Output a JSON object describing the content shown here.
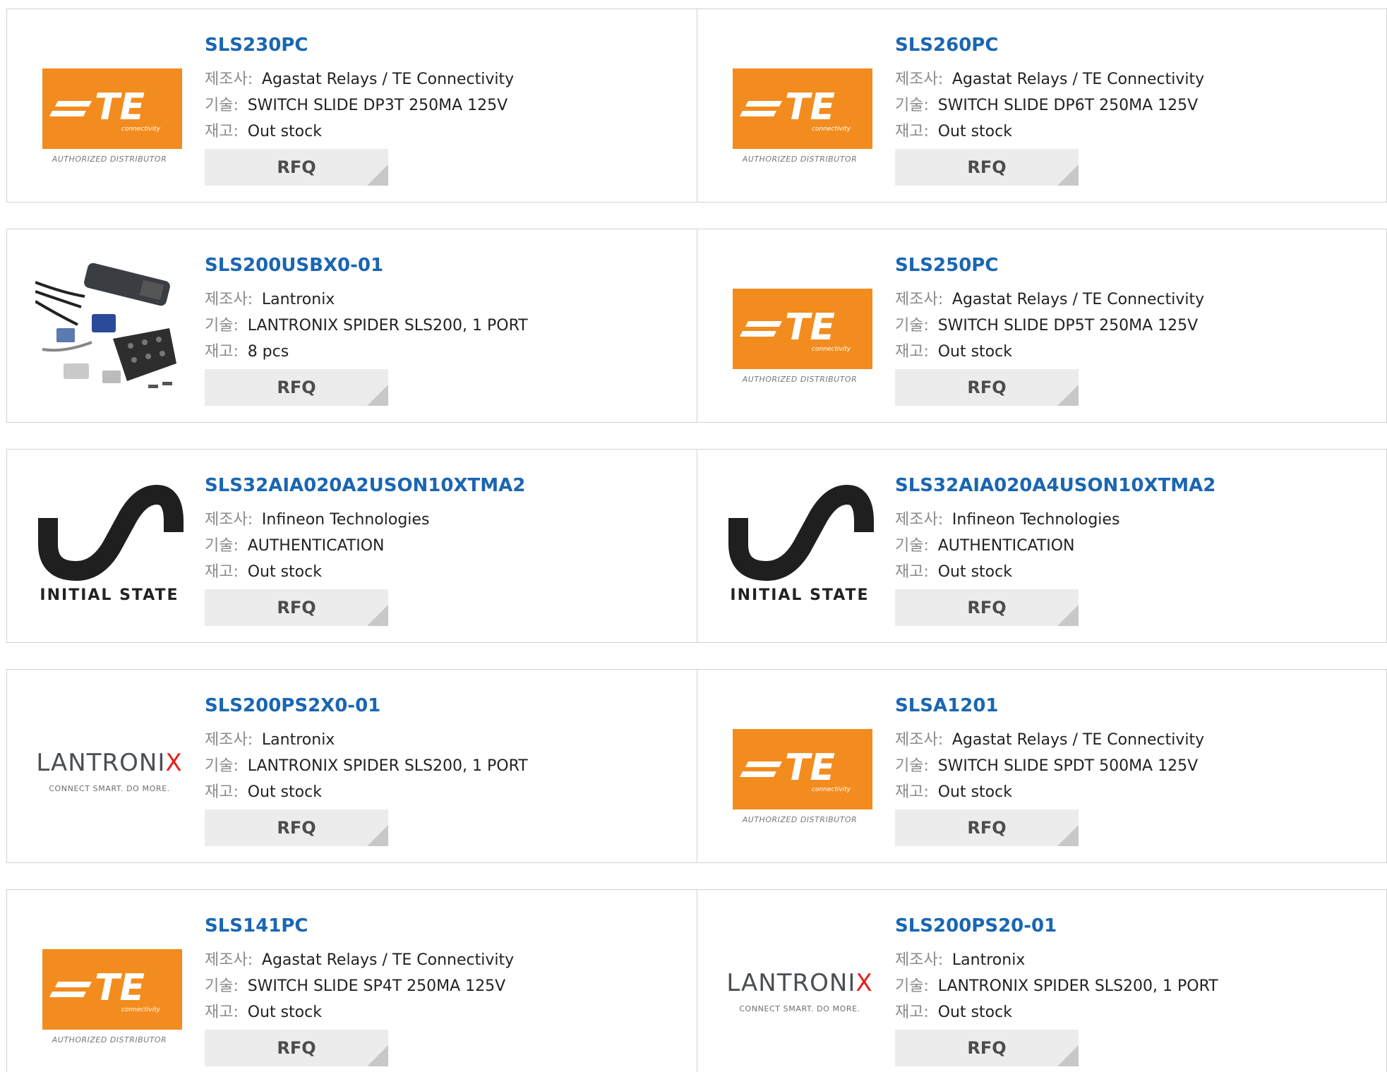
{
  "labels": {
    "manufacturer": "제조사:",
    "description": "기술:",
    "stock": "재고:",
    "rfq": "RFQ"
  },
  "colors": {
    "part_link": "#1a66b2",
    "te_orange": "#f28c1e",
    "lantronix_red": "#e2231a"
  },
  "products": [
    {
      "part": "SLS230PC",
      "logo": "te-connectivity-logo",
      "logo_text": {
        "brand": "TE",
        "sub": "connectivity",
        "caption": "AUTHORIZED DISTRIBUTOR"
      },
      "manufacturer": "Agastat Relays / TE Connectivity",
      "description": "SWITCH SLIDE DP3T 250MA 125V",
      "stock": "Out stock"
    },
    {
      "part": "SLS260PC",
      "logo": "te-connectivity-logo",
      "logo_text": {
        "brand": "TE",
        "sub": "connectivity",
        "caption": "AUTHORIZED DISTRIBUTOR"
      },
      "manufacturer": "Agastat Relays / TE Connectivity",
      "description": "SWITCH SLIDE DP6T 250MA 125V",
      "stock": "Out stock"
    },
    {
      "part": "SLS200USBX0-01",
      "logo": "product-photo-kvm-adapter",
      "manufacturer": "Lantronix",
      "description": "LANTRONIX SPIDER SLS200, 1 PORT",
      "stock": "8 pcs"
    },
    {
      "part": "SLS250PC",
      "logo": "te-connectivity-logo",
      "logo_text": {
        "brand": "TE",
        "sub": "connectivity",
        "caption": "AUTHORIZED DISTRIBUTOR"
      },
      "manufacturer": "Agastat Relays / TE Connectivity",
      "description": "SWITCH SLIDE DP5T 250MA 125V",
      "stock": "Out stock"
    },
    {
      "part": "SLS32AIA020A2USON10XTMA2",
      "logo": "initial-state-logo",
      "logo_text": {
        "caption": "INITIAL STATE"
      },
      "manufacturer": "Infineon Technologies",
      "description": "AUTHENTICATION",
      "stock": "Out stock"
    },
    {
      "part": "SLS32AIA020A4USON10XTMA2",
      "logo": "initial-state-logo",
      "logo_text": {
        "caption": "INITIAL STATE"
      },
      "manufacturer": "Infineon Technologies",
      "description": "AUTHENTICATION",
      "stock": "Out stock"
    },
    {
      "part": "SLS200PS2X0-01",
      "logo": "lantronix-logo",
      "logo_text": {
        "word": "LANTRONI",
        "x": "X",
        "tag": "CONNECT SMART. DO MORE."
      },
      "manufacturer": "Lantronix",
      "description": "LANTRONIX SPIDER SLS200, 1 PORT",
      "stock": "Out stock"
    },
    {
      "part": "SLSA1201",
      "logo": "te-connectivity-logo",
      "logo_text": {
        "brand": "TE",
        "sub": "connectivity",
        "caption": "AUTHORIZED DISTRIBUTOR"
      },
      "manufacturer": "Agastat Relays / TE Connectivity",
      "description": "SWITCH SLIDE SPDT 500MA 125V",
      "stock": "Out stock"
    },
    {
      "part": "SLS141PC",
      "logo": "te-connectivity-logo",
      "logo_text": {
        "brand": "TE",
        "sub": "connectivity",
        "caption": "AUTHORIZED DISTRIBUTOR"
      },
      "manufacturer": "Agastat Relays / TE Connectivity",
      "description": "SWITCH SLIDE SP4T 250MA 125V",
      "stock": "Out stock"
    },
    {
      "part": "SLS200PS20-01",
      "logo": "lantronix-logo",
      "logo_text": {
        "word": "LANTRONI",
        "x": "X",
        "tag": "CONNECT SMART. DO MORE."
      },
      "manufacturer": "Lantronix",
      "description": "LANTRONIX SPIDER SLS200, 1 PORT",
      "stock": "Out stock"
    }
  ]
}
